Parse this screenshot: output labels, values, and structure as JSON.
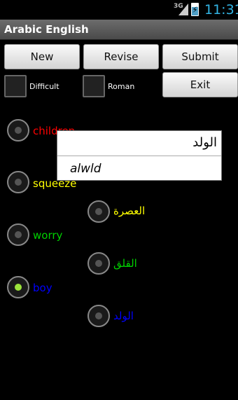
{
  "status": {
    "network": "3G",
    "time": "11:31"
  },
  "app": {
    "title": "Arabic English"
  },
  "buttons": {
    "new": "New",
    "revise": "Revise",
    "submit": "Submit",
    "exit": "Exit"
  },
  "checkboxes": {
    "difficult": "Difficult",
    "roman": "Roman"
  },
  "options": [
    {
      "label": "children",
      "color": "#ff0000",
      "checked": false
    },
    {
      "label": "squeeze",
      "color": "#ffff00",
      "checked": false
    },
    {
      "label": "العصرة",
      "color": "#ffff00",
      "checked": false
    },
    {
      "label": "worry",
      "color": "#00d000",
      "checked": false
    },
    {
      "label": "القلق",
      "color": "#00d000",
      "checked": false
    },
    {
      "label": "boy",
      "color": "#0000ff",
      "checked": true
    },
    {
      "label": "الولد",
      "color": "#0000ff",
      "checked": false
    }
  ],
  "popup": {
    "arabic": "الولد",
    "roman": "alwld"
  }
}
